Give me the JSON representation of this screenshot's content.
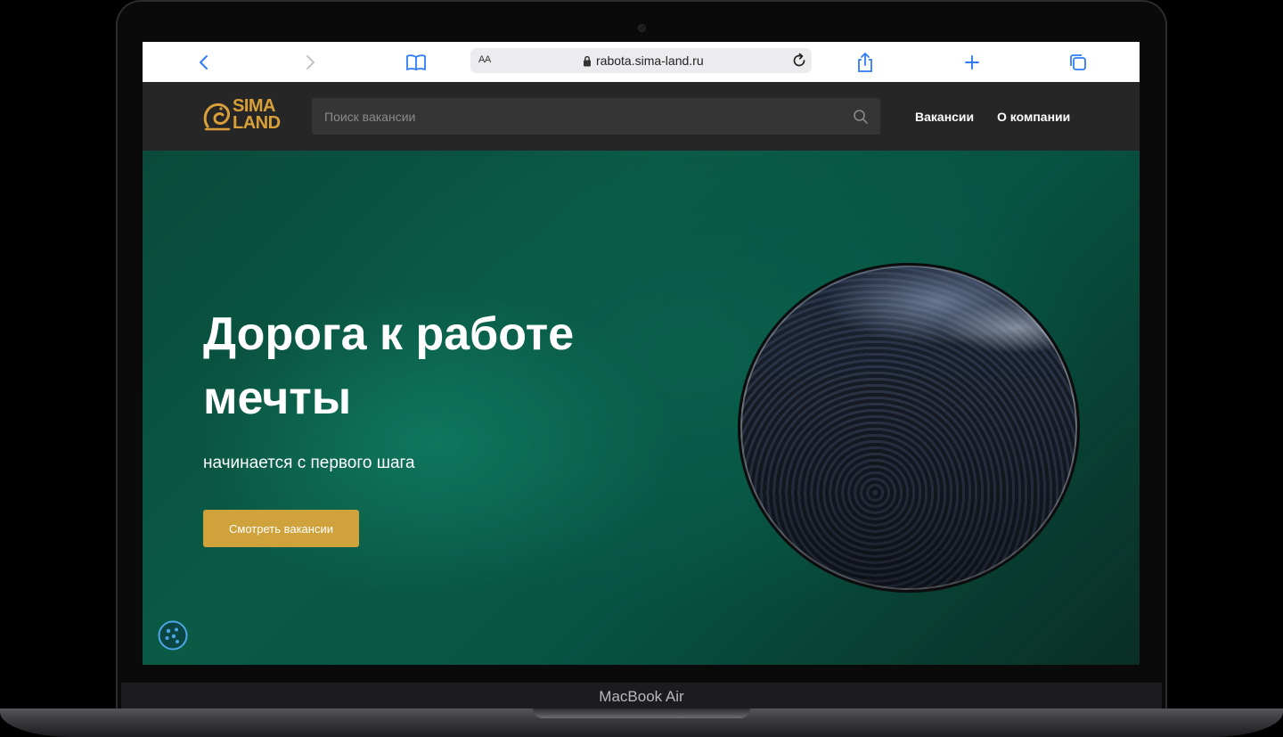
{
  "browser": {
    "text_size_label": "AA",
    "url": "rabota.sima-land.ru"
  },
  "site": {
    "logo_line1": "SIMA",
    "logo_line2": "LAND",
    "search_placeholder": "Поиск вакансии",
    "nav": [
      "Вакансии",
      "О компании"
    ]
  },
  "hero": {
    "title": "Дорога к работе мечты",
    "subtitle": "начинается с первого шага",
    "cta_label": "Смотреть вакансии"
  },
  "device_label": "MacBook Air",
  "colors": {
    "brand_gold": "#cfa23c",
    "header_bg": "#262626",
    "hero_green": "#0a5a46",
    "safari_blue": "#2f7cf6"
  },
  "icons": [
    "back-icon",
    "forward-icon",
    "bookmarks-icon",
    "lock-icon",
    "reload-icon",
    "share-icon",
    "new-tab-icon",
    "tabs-icon",
    "search-icon",
    "cookie-icon"
  ]
}
